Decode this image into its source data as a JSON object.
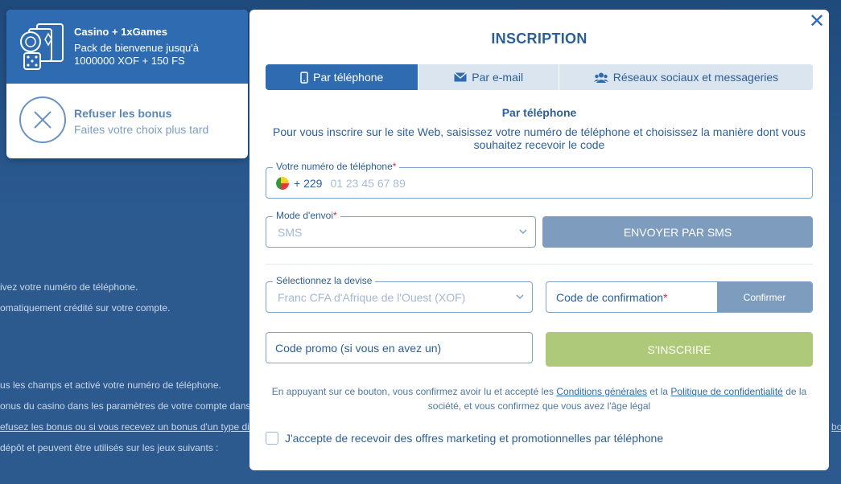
{
  "background": {
    "lines": [
      "ivez votre numéro de téléphone.",
      "omatiquement crédité sur votre compte.",
      "us les champs et activé votre numéro de téléphone.",
      "onus du casino dans les paramètres de votre compte dans",
      "efusez les bonus ou si vous recevez un bonus d'un type diff",
      "dépôt et peuvent être utilisés sur les jeux suivants :"
    ],
    "side_fragment": "bo"
  },
  "bonus_panel": {
    "title": "Casino + 1xGames",
    "description": "Pack de bienvenue jusqu'à 1000000 XOF + 150 FS",
    "icon": "casino-cards-dice-icon",
    "refuse_title": "Refuser les bonus",
    "refuse_subtitle": "Faites votre choix plus tard",
    "refuse_icon": "close-circle-icon"
  },
  "modal": {
    "title": "INSCRIPTION",
    "close_icon": "close-icon",
    "tabs": [
      {
        "label": "Par téléphone",
        "icon": "phone-icon",
        "active": true
      },
      {
        "label": "Par e-mail",
        "icon": "envelope-icon",
        "active": false
      },
      {
        "label": "Réseaux sociaux et messageries",
        "icon": "users-icon",
        "active": false
      }
    ],
    "section_title": "Par téléphone",
    "section_description": "Pour vous inscrire sur le site Web, saisissez votre numéro de téléphone et choisissez la manière dont vous souhaitez recevoir le code",
    "phone": {
      "label": "Votre numéro de téléphone",
      "required": "*",
      "country_code": "+ 229",
      "placeholder": "01 23 45 67 89",
      "flag": "benin-flag-icon"
    },
    "send_mode": {
      "label": "Mode d'envoi",
      "required": "*",
      "value": "SMS"
    },
    "send_button": "ENVOYER PAR SMS",
    "currency": {
      "label": "Sélectionnez la devise",
      "value": "Franc CFA d'Afrique de l'Ouest (XOF)"
    },
    "confirmation": {
      "label": "Code de confirmation",
      "required": "*",
      "button": "Confirmer"
    },
    "promo_placeholder": "Code promo (si vous en avez un)",
    "register_button": "S'INSCRIRE",
    "legal": {
      "part1": "En appuyant sur ce bouton, vous confirmez avoir lu et accepté les ",
      "terms_link": "Conditions générales",
      "part2": " et la ",
      "privacy_link": "Politique de confidentialité",
      "part3": " de la société, et vous confirmez que vous avez l'âge légal"
    },
    "marketing_checkbox": "J'accepte de recevoir des offres marketing et promotionnelles par téléphone"
  },
  "colors": {
    "primary": "#2f6bb0",
    "text": "#2b5f98",
    "button_disabled": "#7e9dbe",
    "register": "#aec97a",
    "required": "#e2253c"
  }
}
